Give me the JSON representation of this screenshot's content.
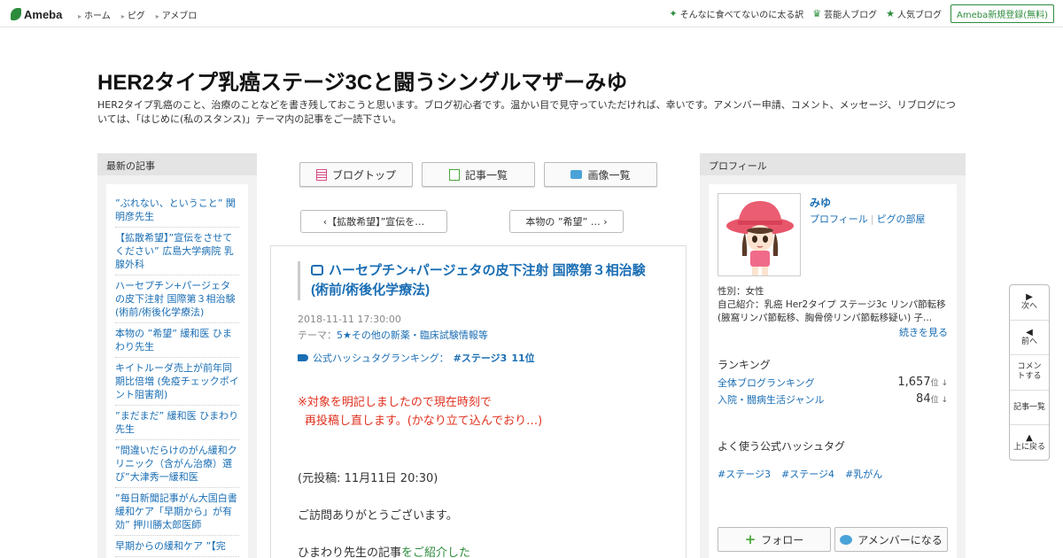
{
  "header": {
    "logo": "Ameba",
    "nav": [
      "ホーム",
      "ピグ",
      "アメブロ"
    ],
    "right_links": [
      {
        "icon": "sparkle-icon",
        "label": "そんなに食べてないのに太る訳"
      },
      {
        "icon": "crown-icon",
        "label": "芸能人ブログ"
      },
      {
        "icon": "star-icon",
        "label": "人気ブログ"
      }
    ],
    "register": "Ameba新規登録(無料)"
  },
  "blog": {
    "title": "HER2タイプ乳癌ステージ3Cと闘うシングルマザーみゆ",
    "description": "HER2タイプ乳癌のこと、治療のことなどを書き残しておこうと思います。ブログ初心者です。温かい目で見守っていただければ、幸いです。アメンバー申請、コメント、メッセージ、リブログについては、「はじめに(私のスタンス)」テーマ内の記事をご一読下さい。"
  },
  "sidebar_left": {
    "heading": "最新の記事",
    "entries": [
      "”ぶれない、ということ” 関明彦先生",
      "【拡散希望】”宣伝をさせてください” 広島大学病院 乳腺外科",
      "ハーセプチン+パージェタの皮下注射 国際第３相治験(術前/術後化学療法)",
      "本物の ”希望” 緩和医 ひまわり先生",
      "キイトルーダ売上が前年同期比倍増 (免疫チェックポイント阻害剤)",
      "”まだまだ” 緩和医 ひまわり先生",
      "”間違いだらけのがん緩和クリニック（含がん治療）選び”大津秀一緩和医",
      "”毎日新聞記事がん大国白書 緩和ケア「早期から」が有効” 押川勝太郎医師",
      "早期からの緩和ケア ”【完"
    ]
  },
  "center": {
    "tabs": [
      {
        "icon": "blog-top-icon",
        "label": "ブログトップ"
      },
      {
        "icon": "article-list-icon",
        "label": "記事一覧"
      },
      {
        "icon": "image-list-icon",
        "label": "画像一覧"
      }
    ],
    "prev": "‹【拡散希望】”宣伝を…",
    "next": "本物の ”希望” … ›",
    "article": {
      "title": "ハーセプチン+パージェタの皮下注射 国際第３相治験(術前/術後化学療法)",
      "date": "2018-11-11 17:30:00",
      "theme_label": "テーマ：",
      "theme": "5★その他の新薬・臨床試験情報等",
      "hashtag_label": "公式ハッシュタグランキング：",
      "hashtag": "#ステージ3",
      "hashtag_rank": "11位",
      "notice_line1": "※対象を明記しましたので現在時刻で",
      "notice_line2": "再投稿し直します。(かなり立て込んでおり…)",
      "orig": "(元投稿: 11月11日 20:30)",
      "greeting": "ご訪問ありがとうございます。",
      "intro_a": "ひまわり先生の記事",
      "intro_b": "をご紹介した"
    }
  },
  "sidebar_right": {
    "heading": "プロフィール",
    "name": "みゆ",
    "links": [
      "プロフィール",
      "ピグの部屋"
    ],
    "gender": "性別：女性",
    "bio": "自己紹介：乳癌 Her2タイプ ステージ3c リンパ節転移 (腋窩リンパ節転移、胸骨傍リンパ節転移疑い) 子...",
    "more": "続きを見る",
    "ranking_heading": "ランキング",
    "rankings": [
      {
        "label": "全体ブログランキング",
        "value": "1,657",
        "unit": "位 ↓"
      },
      {
        "label": "入院・闘病生活ジャンル",
        "value": "84",
        "unit": "位 ↓"
      }
    ],
    "hash_heading": "よく使う公式ハッシュタグ",
    "hashtags": [
      "#ステージ3",
      "#ステージ4",
      "#乳がん"
    ],
    "follow": "フォロー",
    "member": "アメンバーになる"
  },
  "float_nav": [
    {
      "arrow": "▶",
      "label": "次へ"
    },
    {
      "arrow": "◀",
      "label": "前へ"
    },
    {
      "arrow": "",
      "label": "コメントする"
    },
    {
      "arrow": "",
      "label": "記事一覧"
    },
    {
      "arrow": "▲",
      "label": "上に戻る"
    }
  ]
}
